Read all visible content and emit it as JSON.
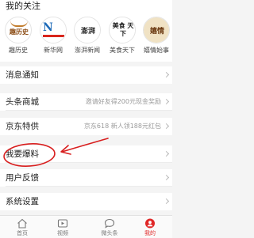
{
  "follow": {
    "title": "我的关注",
    "accounts": [
      {
        "name": "趣历史",
        "logo_text": "趣历史"
      },
      {
        "name": "新华网",
        "logo_text": "N"
      },
      {
        "name": "澎湃新闻",
        "logo_text": "澎湃"
      },
      {
        "name": "美食天下",
        "logo_text": "美食 天下"
      },
      {
        "name": "嬉情始事",
        "logo_text": "嬉情"
      }
    ]
  },
  "menu": [
    {
      "label": "消息通知",
      "hint": ""
    },
    {
      "label": "头条商城",
      "hint": "邀请好友得200元现金奖励"
    },
    {
      "label": "京东特供",
      "hint": "京东618 新人领188元红包"
    },
    {
      "label": "我要爆料",
      "hint": ""
    },
    {
      "label": "用户反馈",
      "hint": ""
    },
    {
      "label": "系统设置",
      "hint": ""
    }
  ],
  "tabs": [
    {
      "label": "首页",
      "icon": "home-icon"
    },
    {
      "label": "视频",
      "icon": "video-icon"
    },
    {
      "label": "微头条",
      "icon": "chat-bubble-icon"
    },
    {
      "label": "我的",
      "icon": "profile-icon",
      "active": true
    }
  ],
  "colors": {
    "accent": "#e02828",
    "annotation": "#d81e1e"
  }
}
